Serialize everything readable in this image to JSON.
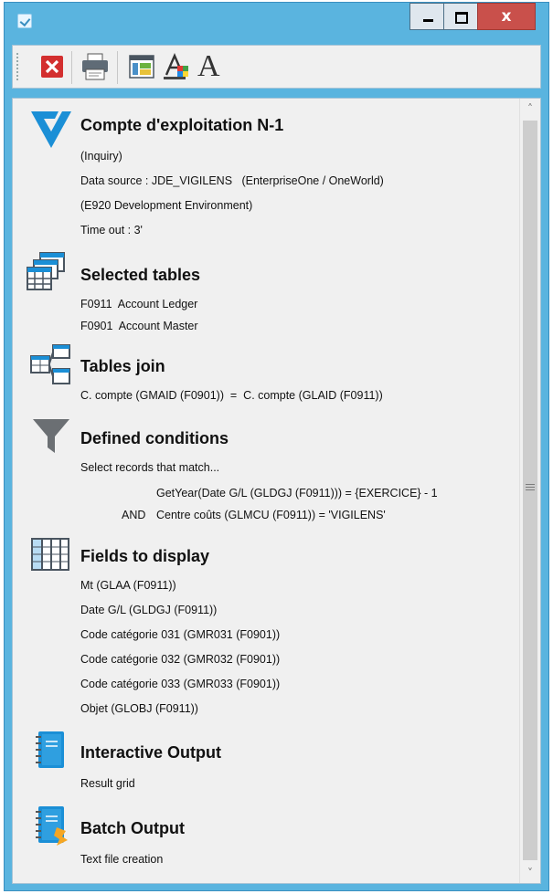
{
  "window": {
    "close_glyph": "x",
    "colors": {
      "frame": "#5ab4df",
      "close": "#c9504b",
      "content": "#f0f0f0"
    }
  },
  "toolbar": {
    "icons": [
      "close-report-icon",
      "print-icon",
      "window-layout-icon",
      "text-color-icon",
      "font-icon"
    ],
    "font_glyph": "A"
  },
  "header": {
    "title": "Compte d'exploitation N-1",
    "mode": "(Inquiry)",
    "data_source": "Data source : JDE_VIGILENS   (EnterpriseOne / OneWorld)",
    "environment": "(E920 Development Environment)",
    "timeout": "Time out : 3'"
  },
  "selected_tables": {
    "title": "Selected tables",
    "items": [
      "F0911  Account Ledger",
      "F0901  Account Master"
    ]
  },
  "tables_join": {
    "title": "Tables join",
    "join": "C. compte (GMAID (F0901))  =  C. compte (GLAID (F0911))"
  },
  "conditions": {
    "title": "Defined conditions",
    "intro": "Select records that match...",
    "cond1": "GetYear(Date G/L (GLDGJ (F0911))) = {EXERCICE} - 1",
    "and_label": "AND",
    "cond2": "Centre coûts (GLMCU (F0911)) = 'VIGILENS'"
  },
  "fields": {
    "title": "Fields to display",
    "items": [
      "Mt (GLAA (F0911))",
      "Date G/L (GLDGJ (F0911))",
      "Code catégorie 031 (GMR031 (F0901))",
      "Code catégorie 032 (GMR032 (F0901))",
      "Code catégorie 033 (GMR033 (F0901))",
      "Objet (GLOBJ (F0911))"
    ]
  },
  "interactive_output": {
    "title": "Interactive Output",
    "detail": "Result grid"
  },
  "batch_output": {
    "title": "Batch Output",
    "detail": "Text file creation"
  },
  "scrollbar": {
    "up": "˄",
    "down": "˅"
  }
}
